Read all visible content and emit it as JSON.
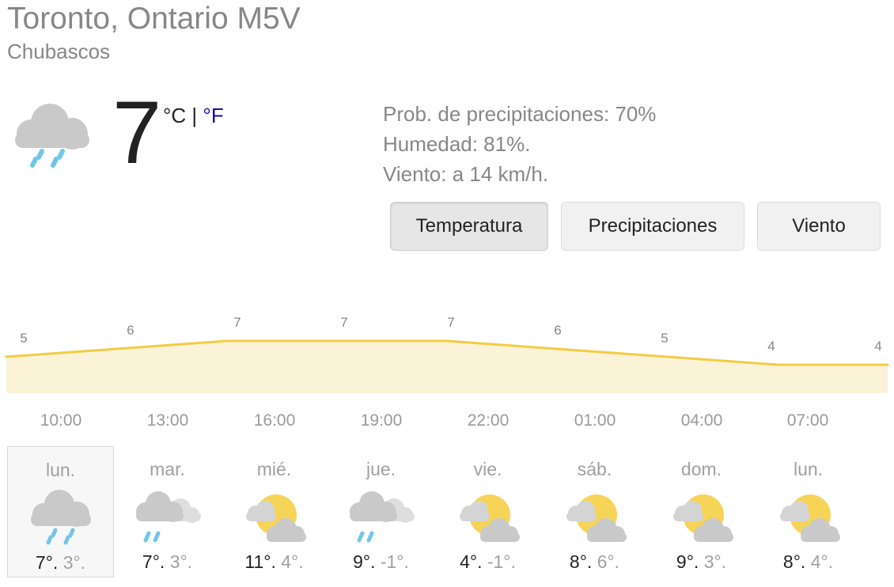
{
  "location": "Toronto, Ontario M5V",
  "condition": "Chubascos",
  "current": {
    "temp": "7",
    "unit_c": "°C",
    "sep": "|",
    "unit_f": "°F",
    "icon": "showers-icon"
  },
  "details": {
    "precip": "Prob. de precipitaciones: 70%",
    "humidity": "Humedad: 81%.",
    "wind": "Viento: a 14 km/h."
  },
  "tabs": [
    {
      "label": "Temperatura",
      "active": true
    },
    {
      "label": "Precipitaciones",
      "active": false
    },
    {
      "label": "Viento",
      "active": false
    }
  ],
  "chart_data": {
    "type": "area",
    "x": [
      "10:00",
      "13:00",
      "16:00",
      "19:00",
      "22:00",
      "01:00",
      "04:00",
      "07:00",
      "10:00"
    ],
    "values": [
      5,
      6,
      7,
      7,
      7,
      6,
      5,
      4,
      4
    ],
    "labels": [
      "5",
      "6",
      "7",
      "7",
      "7",
      "6",
      "5",
      "4",
      "4"
    ],
    "tick_labels": [
      "10:00",
      "13:00",
      "16:00",
      "19:00",
      "22:00",
      "01:00",
      "04:00",
      "07:00"
    ],
    "color": "#f4cb42",
    "fill": "#fbf3d8"
  },
  "days": [
    {
      "name": "lun.",
      "hi": "7°.",
      "lo": "3°.",
      "icon": "showers-icon",
      "selected": true
    },
    {
      "name": "mar.",
      "hi": "7°.",
      "lo": "3°.",
      "icon": "rain-clouds-icon",
      "selected": false
    },
    {
      "name": "mié.",
      "hi": "11°.",
      "lo": "4°.",
      "icon": "partly-cloudy-night-icon",
      "selected": false
    },
    {
      "name": "jue.",
      "hi": "9°.",
      "lo": "-1°.",
      "icon": "rain-clouds-icon",
      "selected": false
    },
    {
      "name": "vie.",
      "hi": "4°.",
      "lo": "-1°.",
      "icon": "partly-cloudy-night-icon",
      "selected": false
    },
    {
      "name": "sáb.",
      "hi": "8°.",
      "lo": "6°.",
      "icon": "partly-cloudy-night-icon",
      "selected": false
    },
    {
      "name": "dom.",
      "hi": "9°.",
      "lo": "3°.",
      "icon": "partly-cloudy-night-icon",
      "selected": false
    },
    {
      "name": "lun.",
      "hi": "8°.",
      "lo": "4°.",
      "icon": "partly-cloudy-night-icon",
      "selected": false
    }
  ]
}
